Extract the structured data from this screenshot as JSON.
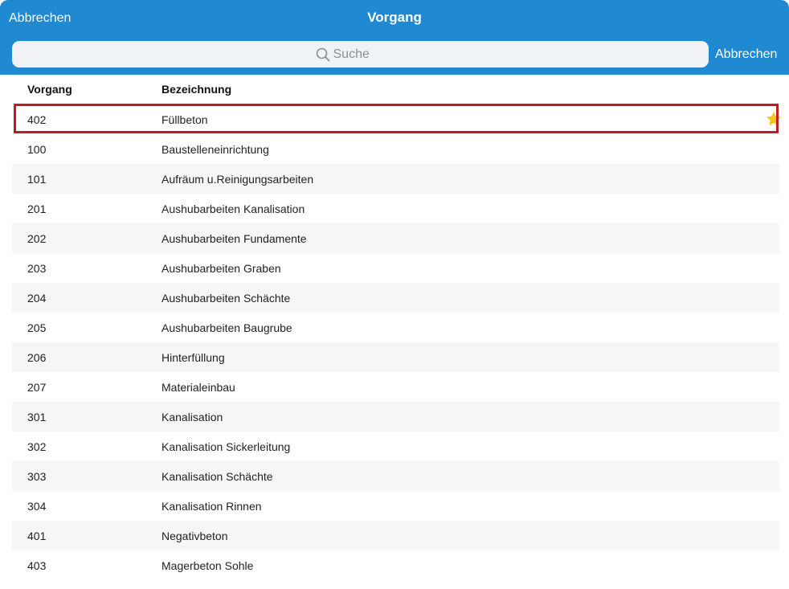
{
  "header": {
    "cancel_label": "Abbrechen",
    "title": "Vorgang"
  },
  "search": {
    "placeholder": "Suche",
    "cancel_label": "Abbrechen"
  },
  "table": {
    "columns": [
      "Vorgang",
      "Bezeichnung"
    ],
    "rows": [
      {
        "id": "402",
        "name": "Füllbeton",
        "favorite": true,
        "selected": true
      },
      {
        "id": "100",
        "name": "Baustelleneinrichtung"
      },
      {
        "id": "101",
        "name": "Aufräum u.Reinigungsarbeiten"
      },
      {
        "id": "201",
        "name": "Aushubarbeiten Kanalisation"
      },
      {
        "id": "202",
        "name": "Aushubarbeiten Fundamente"
      },
      {
        "id": "203",
        "name": "Aushubarbeiten Graben"
      },
      {
        "id": "204",
        "name": "Aushubarbeiten Schächte"
      },
      {
        "id": "205",
        "name": "Aushubarbeiten Baugrube"
      },
      {
        "id": "206",
        "name": "Hinterfüllung"
      },
      {
        "id": "207",
        "name": "Materialeinbau"
      },
      {
        "id": "301",
        "name": "Kanalisation"
      },
      {
        "id": "302",
        "name": "Kanalisation Sickerleitung"
      },
      {
        "id": "303",
        "name": "Kanalisation Schächte"
      },
      {
        "id": "304",
        "name": "Kanalisation Rinnen"
      },
      {
        "id": "401",
        "name": "Negativbeton"
      },
      {
        "id": "403",
        "name": "Magerbeton Sohle"
      }
    ]
  },
  "icons": {
    "search": "search-icon",
    "favorite": "star-icon"
  },
  "colors": {
    "header_bg": "#1f8ad1",
    "selection_border": "#b81e23",
    "star": "#f5c518",
    "alt_row": "#f6f6f6"
  }
}
